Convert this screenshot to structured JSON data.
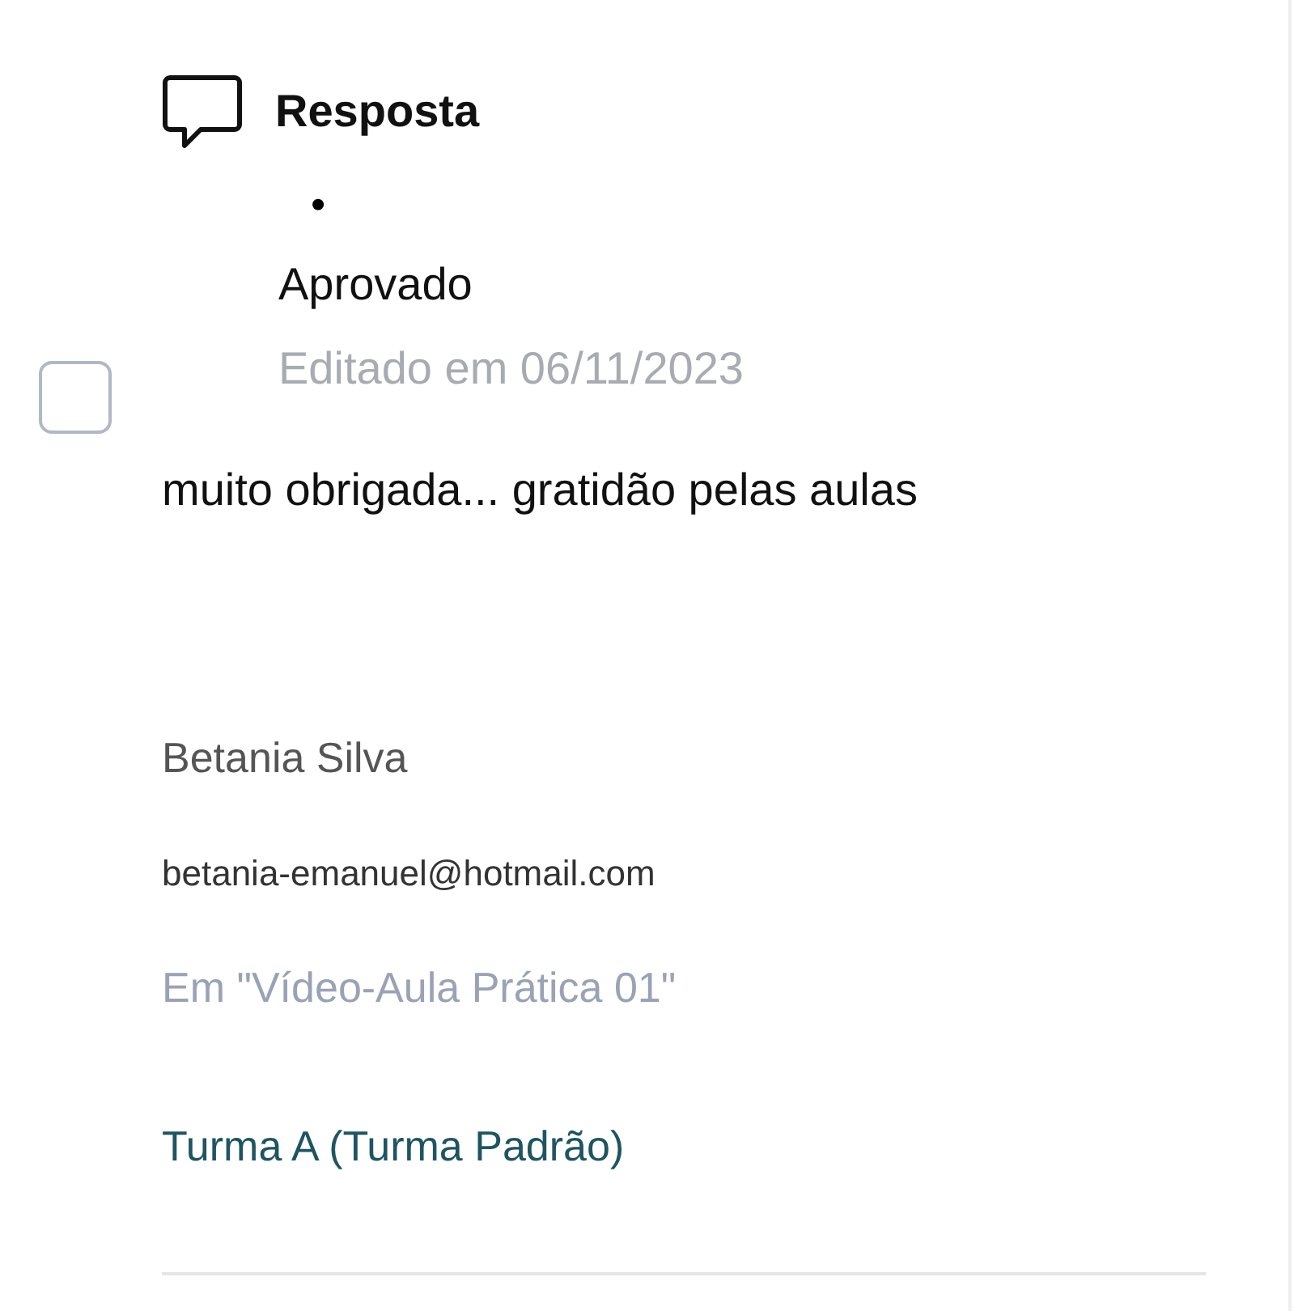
{
  "comment": {
    "checked": false,
    "type_label": "Resposta",
    "bullet": "•",
    "status": "Aprovado",
    "edited": "Editado em 06/11/2023",
    "text": "muito obrigada... gratidão pelas aulas",
    "author": "Betania Silva",
    "email": "betania-emanuel@hotmail.com",
    "context": "Em \"Vídeo-Aula Prática 01\"",
    "group": "Turma A (Turma Padrão)"
  }
}
